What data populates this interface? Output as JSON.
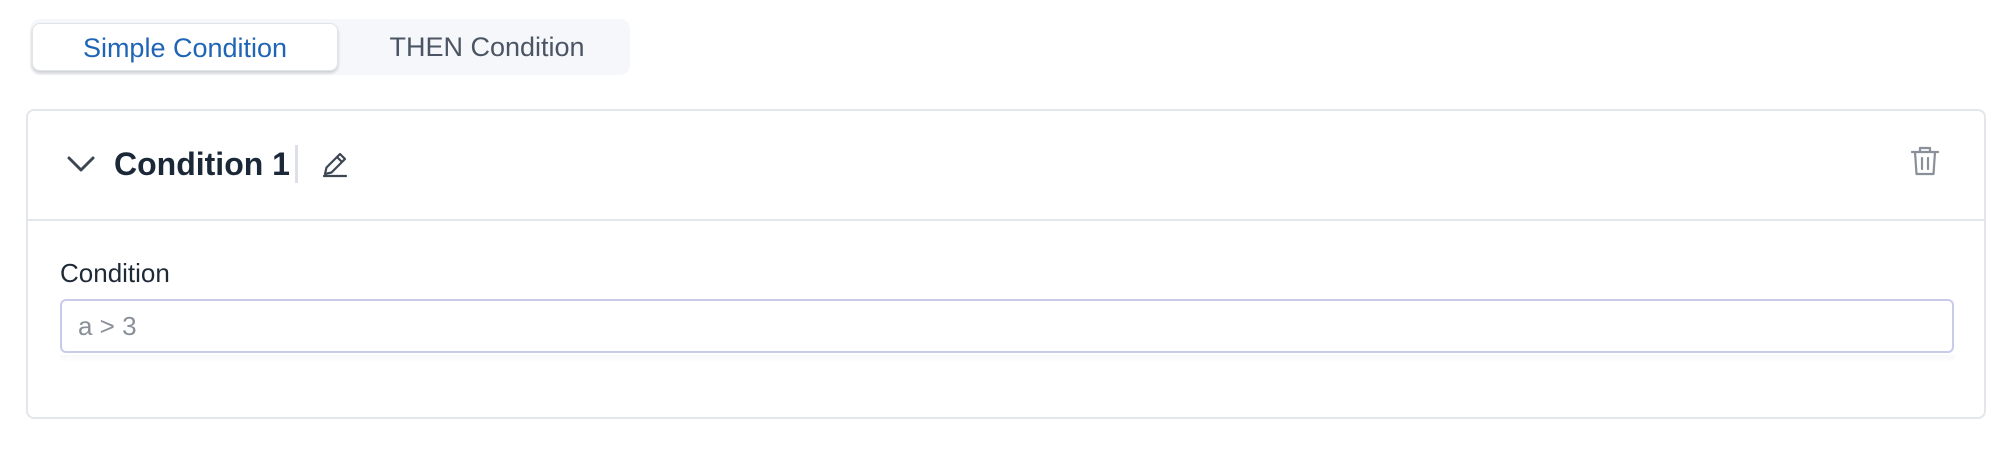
{
  "tabs": {
    "items": [
      {
        "label": "Simple Condition",
        "active": true
      },
      {
        "label": "THEN Condition",
        "active": false
      }
    ]
  },
  "card": {
    "title": "Condition 1",
    "icons": {
      "collapse": "chevron-down-icon",
      "edit": "pencil-icon",
      "delete": "trash-icon"
    }
  },
  "field": {
    "label": "Condition",
    "value": "",
    "placeholder": "a > 3"
  },
  "colors": {
    "accent": "#1f65b5",
    "border": "#e3e6ea",
    "input_border": "#c9cbeb",
    "tab_background": "#f5f7fa"
  }
}
